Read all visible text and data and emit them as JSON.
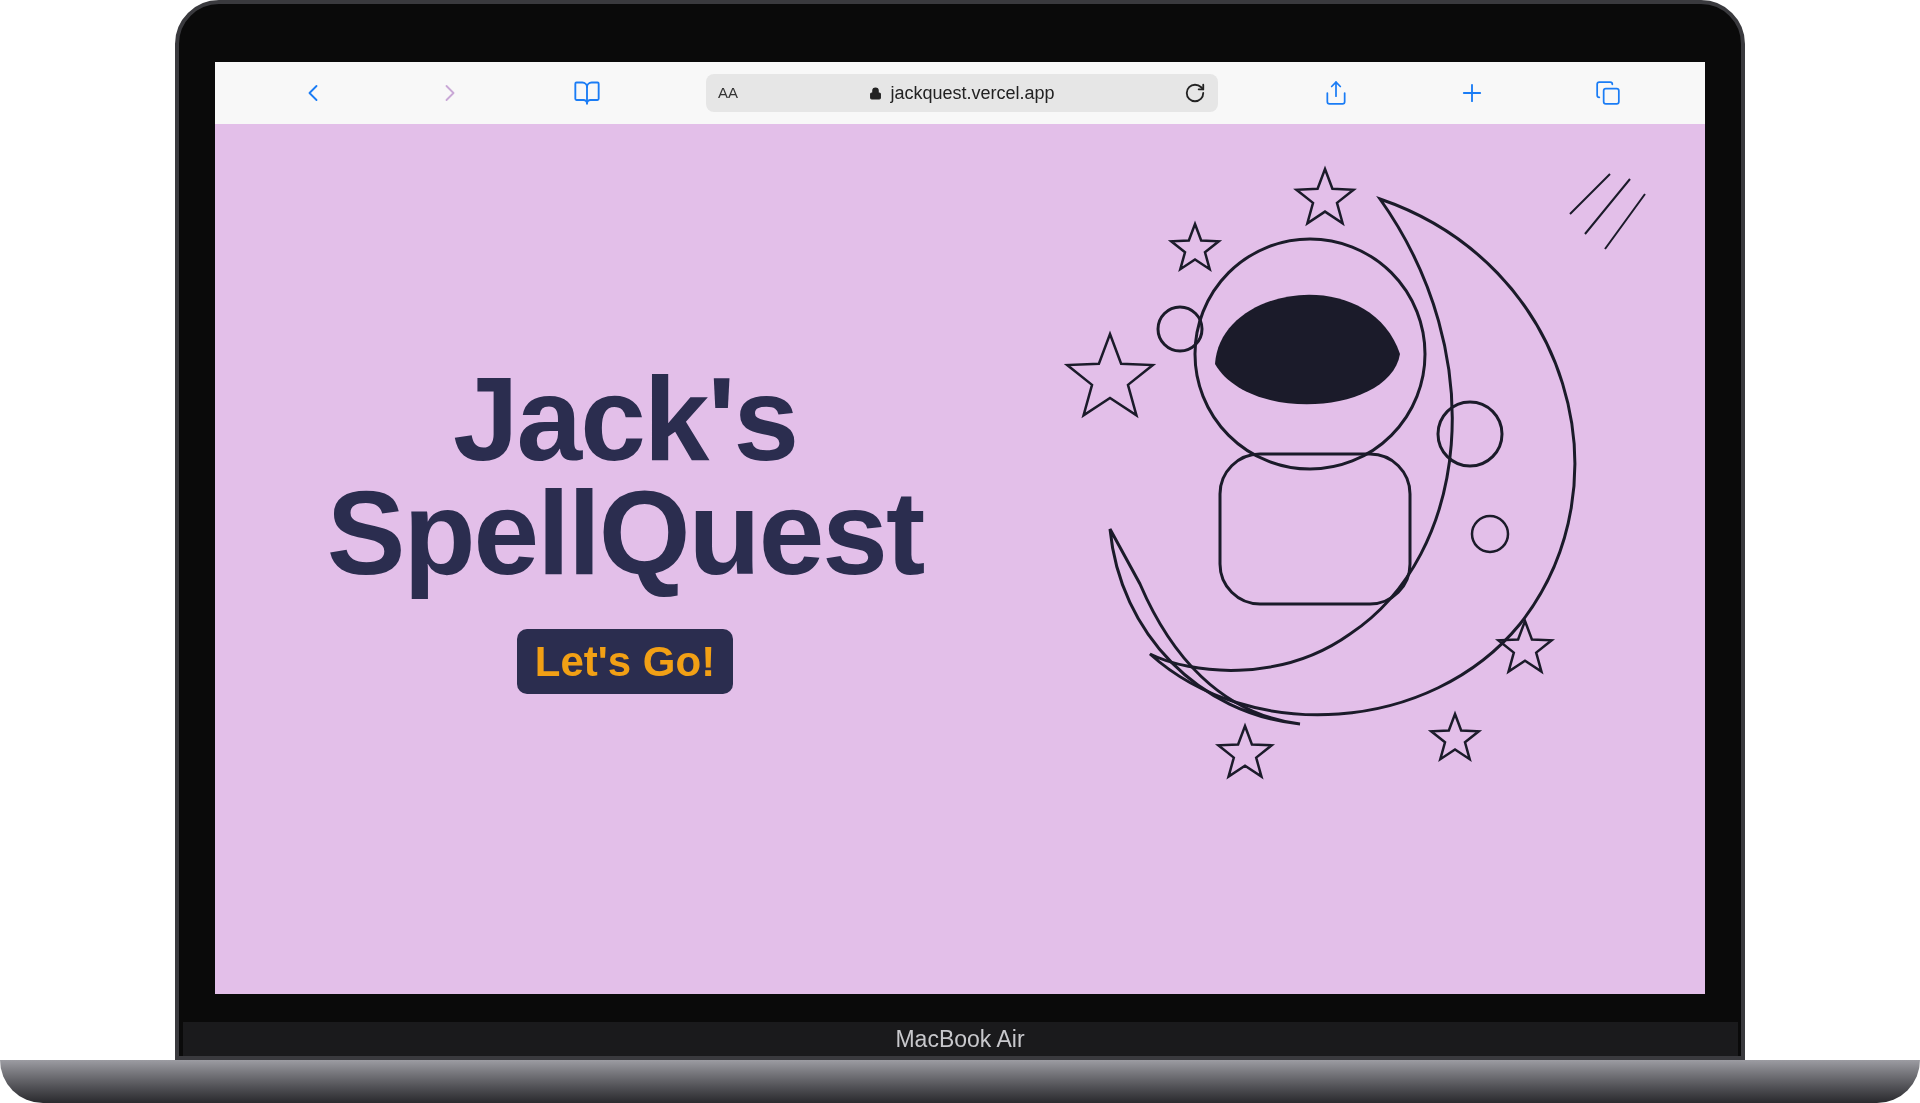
{
  "browser": {
    "back": {
      "disabled": false
    },
    "forward": {
      "disabled": true
    },
    "reader_label": "AA",
    "url": "jackquest.vercel.app"
  },
  "hero": {
    "title_lines": [
      "Jack's",
      "SpellQuest"
    ],
    "button": "Let's Go!"
  },
  "device": {
    "label": "MacBook Air"
  }
}
